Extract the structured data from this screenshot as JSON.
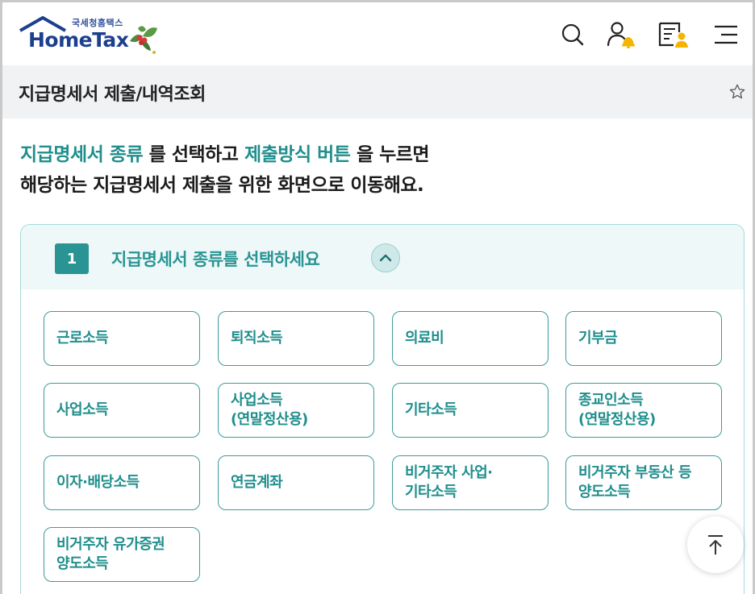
{
  "header": {
    "logo_sub": "국세청홈택스",
    "logo_main": "HomeTax",
    "icons": [
      "search-icon",
      "user-bell-icon",
      "document-user-icon",
      "menu-icon"
    ]
  },
  "titlebar": {
    "title": "지급명세서 제출/내역조회",
    "favorite_icon": "star-icon"
  },
  "intro": {
    "hl1": "지급명세서 종류",
    "t1": " 를 선택하고 ",
    "hl2": "제출방식 버튼",
    "t2": " 을 누르면",
    "line2": "해당하는 지급명세서 제출을 위한 화면으로 이동해요."
  },
  "section": {
    "step": "1",
    "title": "지급명세서 종류를 선택하세요"
  },
  "options": [
    "근로소득",
    "퇴직소득",
    "의료비",
    "기부금",
    "사업소득",
    "사업소득\n(연말정산용)",
    "기타소득",
    "종교인소득\n(연말정산용)",
    "이자·배당소득",
    "연금계좌",
    "비거주자 사업·\n기타소득",
    "비거주자 부동산 등\n양도소득",
    "비거주자 유가증권\n양도소득"
  ],
  "colors": {
    "accent": "#2a9494",
    "brand": "#1d3f8f",
    "panel_bg": "#eef8f8"
  }
}
